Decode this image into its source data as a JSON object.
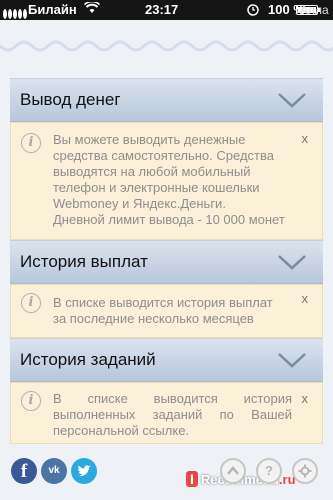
{
  "status_bar": {
    "carrier": "Билайн",
    "time": "23:17",
    "battery_percent": "100 %",
    "overlay_text": "Алла"
  },
  "sections": [
    {
      "title": "Вывод денег",
      "text_lines": [
        "Вы можете выводить денежные",
        "средства самостоятельно. Средства",
        "выводятся на любой мобильный",
        "телефон и электронные кошельки",
        "Webmoney и Яндекс.Деньги.",
        "Дневной лимит вывода - 10 000 монет"
      ],
      "close": "x"
    },
    {
      "title": "История выплат",
      "text_lines": [
        "В списке выводится история выплат",
        "за последние несколько месяцев"
      ],
      "close": "x"
    },
    {
      "title": "История заданий",
      "text_lines": [
        "В списке выводится история",
        "выполненных заданий по Вашей",
        "персональной ссылке."
      ],
      "close": "x"
    }
  ],
  "bottom_bar": {
    "facebook_label": "f",
    "vk_label": "vk",
    "twitter_label": "t",
    "watermark_badge": "I",
    "watermark_text": "Recommend",
    "watermark_tld": ".ru"
  },
  "icons": [
    "signal-icon",
    "wifi-icon",
    "alarm-icon",
    "battery-icon",
    "chevron-down-icon",
    "info-icon",
    "close-icon",
    "facebook-icon",
    "vk-icon",
    "twitter-icon",
    "scroll-up-icon",
    "help-icon",
    "settings-icon"
  ],
  "colors": {
    "header_gradient_top": "#dbe3ef",
    "header_gradient_bottom": "#b8c7da",
    "info_box_bg": "#fbf0d8",
    "facebook": "#3b5998",
    "vk": "#4c75a3",
    "twitter": "#2aa9e0"
  }
}
